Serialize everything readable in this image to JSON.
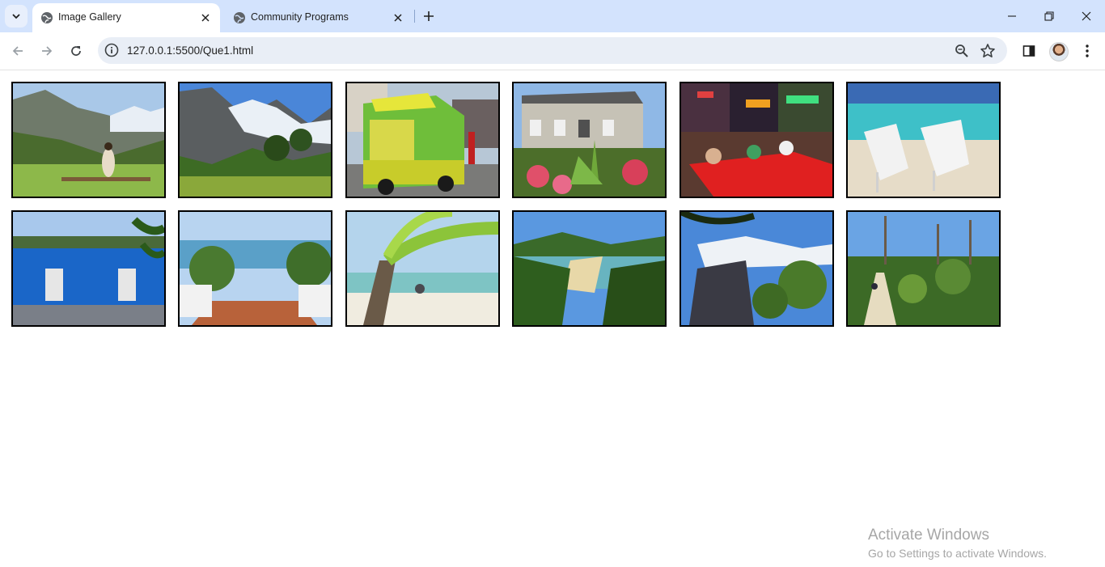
{
  "tabs": [
    {
      "title": "Image Gallery",
      "active": true
    },
    {
      "title": "Community Programs",
      "active": false
    }
  ],
  "address_bar": {
    "url": "127.0.0.1:5500/Que1.html"
  },
  "gallery": {
    "images": [
      {
        "subject": "mountain valley with person on bench"
      },
      {
        "subject": "glacier mountain"
      },
      {
        "subject": "green food truck"
      },
      {
        "subject": "stone house with flowers"
      },
      {
        "subject": "night street market"
      },
      {
        "subject": "beach lounge chairs"
      },
      {
        "subject": "infinity pool with palms"
      },
      {
        "subject": "stairs to bay"
      },
      {
        "subject": "palm tree beach"
      },
      {
        "subject": "rainforest bay"
      },
      {
        "subject": "glacier cliff forest"
      },
      {
        "subject": "forest trail"
      }
    ]
  },
  "watermark": {
    "title": "Activate Windows",
    "subtitle": "Go to Settings to activate Windows."
  }
}
